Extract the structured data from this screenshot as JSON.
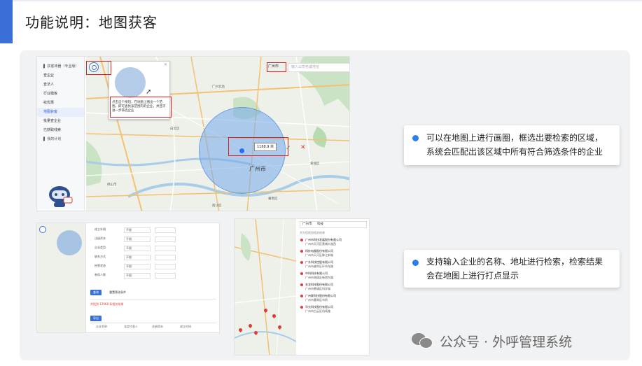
{
  "slide": {
    "title": "功能说明：地图获客"
  },
  "screenshot_main": {
    "sidebar_items": [
      {
        "label": "▌ 获客神器（专业版）",
        "active": false,
        "header": true
      },
      {
        "label": "查企业",
        "active": false
      },
      {
        "label": "查法人",
        "active": false
      },
      {
        "label": "行业模板",
        "active": false
      },
      {
        "label": "找优惠",
        "active": false
      },
      {
        "label": "地图获客",
        "active": true
      },
      {
        "label": "批量查企业",
        "active": false
      },
      {
        "label": "已获取线索",
        "active": false
      },
      {
        "label": "▌ 我的计划",
        "active": false,
        "header": true
      }
    ],
    "popup_text": "点击这个按钮，在地图上圈出一个范围，即可查找该范围内的企业，并且可进一步筛选企业",
    "search_city": "广州市",
    "search_placeholder": "输入公司名或地址",
    "radius_label": "1168.9 米",
    "confirm_glyph": "✓",
    "cancel_glyph": "✕",
    "popup_close": "✕",
    "city_name": "广州市",
    "road_labels": [
      "广州北站",
      "白云区",
      "黄埔区",
      "番禺区",
      "佛山市",
      "南沙区"
    ]
  },
  "screenshot_filter": {
    "rows": [
      {
        "label": "成立年限",
        "value": "不限"
      },
      {
        "label": "注册资本",
        "value": "不限"
      },
      {
        "label": "企业类型",
        "value": "不限"
      },
      {
        "label": "联系方式",
        "value": "不限"
      },
      {
        "label": "经营状态",
        "value": "不限"
      },
      {
        "label": "参保人数",
        "value": "不限"
      }
    ],
    "search_button": "查询",
    "reset_button": "重置筛选条件",
    "result_text": "共找到 12968 条相关结果",
    "export_button": "导出",
    "table_headers": [
      "企业名称",
      "法定代表人",
      "注册资本",
      "成立时间"
    ]
  },
  "screenshot_list": {
    "search_city": "广州市",
    "search_keyword": "科技",
    "result_count": "共为您找到相关结果",
    "items": [
      {
        "name": "广州市科技发展股份有限公司",
        "address": "广州市天河区黄埔大道西"
      },
      {
        "name": "科技电器股份有限公司",
        "address": "广州市天河区珠江新城"
      },
      {
        "name": "广东科技控股有限公司",
        "address": "广州市越秀区环市东路"
      },
      {
        "name": "中科科技有限公司",
        "address": "广州市海珠区新港东路"
      },
      {
        "name": "金龙科技股份有限公司",
        "address": "广州市黄埔区科学城"
      },
      {
        "name": "广州联科技股份有限公司",
        "address": "广州市番禺区市桥"
      },
      {
        "name": "华光科技股份有限公司",
        "address": "广州市白云区机场路"
      }
    ]
  },
  "callouts": [
    {
      "text": "可以在地图上进行画圈，框选出要检索的区域， 系统会匹配出该区域中所有符合筛选条件的企业"
    },
    {
      "text": "支持输入企业的名称、地址进行检索，检索结果 会在地图上进行打点显示"
    }
  ],
  "watermark": {
    "text": "公众号 · 外呼管理系统"
  },
  "colors": {
    "accent": "#3b6fd8",
    "bullet": "#2b7ef0",
    "highlight_red": "#e02020"
  }
}
